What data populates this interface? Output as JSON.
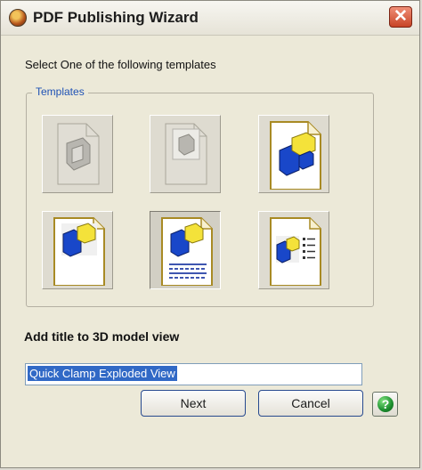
{
  "window": {
    "title": "PDF Publishing Wizard"
  },
  "prompt": "Select One of the following templates",
  "templates_group": {
    "label": "Templates",
    "selected_index": 4,
    "items": [
      {
        "name": "template-1-icon"
      },
      {
        "name": "template-2-icon"
      },
      {
        "name": "template-3-icon"
      },
      {
        "name": "template-4-icon"
      },
      {
        "name": "template-5-icon"
      },
      {
        "name": "template-6-icon"
      }
    ]
  },
  "section_title": "Add title to 3D model view",
  "title_input": {
    "value": "Quick Clamp Exploded View"
  },
  "buttons": {
    "next": "Next",
    "cancel": "Cancel",
    "help": "?"
  },
  "colors": {
    "accent": "#1f52b5",
    "selection": "#3169c6",
    "model_blue": "#1947c9",
    "model_yellow": "#f4e23a"
  }
}
